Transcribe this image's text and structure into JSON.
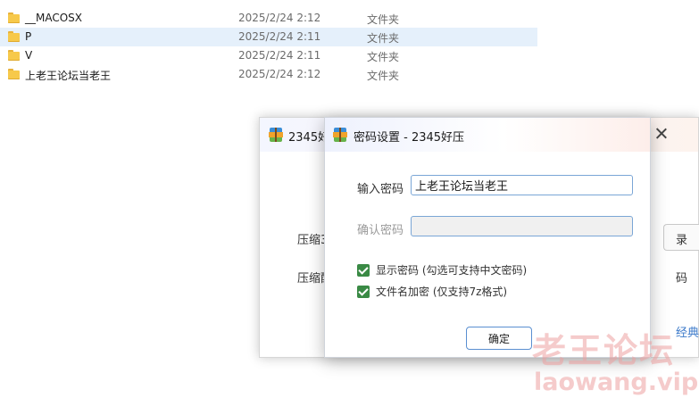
{
  "explorer": {
    "files": [
      {
        "name": "__MACOSX",
        "date": "2025/2/24 2:12",
        "type": "文件夹",
        "icon": "folder-icon"
      },
      {
        "name": "P",
        "date": "2025/2/24 2:11",
        "type": "文件夹",
        "icon": "folder-icon",
        "selected": true
      },
      {
        "name": "V",
        "date": "2025/2/24 2:11",
        "type": "文件夹",
        "icon": "folder-icon"
      },
      {
        "name": "上老王论坛当老王",
        "date": "2025/2/24 2:12",
        "type": "文件夹",
        "icon": "folder-icon"
      }
    ]
  },
  "bg_window": {
    "title": "2345好",
    "label_1": "压缩3",
    "label_2": "压缩配",
    "button_label": "录",
    "right_text": "码",
    "link_text": "经典"
  },
  "dialog": {
    "title": "密码设置 - 2345好压",
    "password_label": "输入密码",
    "password_value": "上老王论坛当老王",
    "confirm_label": "确认密码",
    "confirm_value": "",
    "show_password_label": "显示密码 (勾选可支持中文密码)",
    "show_password_checked": true,
    "encrypt_names_label": "文件名加密 (仅支持7z格式)",
    "encrypt_names_checked": true,
    "ok_label": "确定"
  },
  "watermark": {
    "cn": "老王论坛",
    "en": "laowang.vip"
  },
  "colors": {
    "accent": "#3a8a45",
    "selection": "#e5f0fb",
    "input_border": "#7aa6d6",
    "watermark": "#eca0a0"
  }
}
